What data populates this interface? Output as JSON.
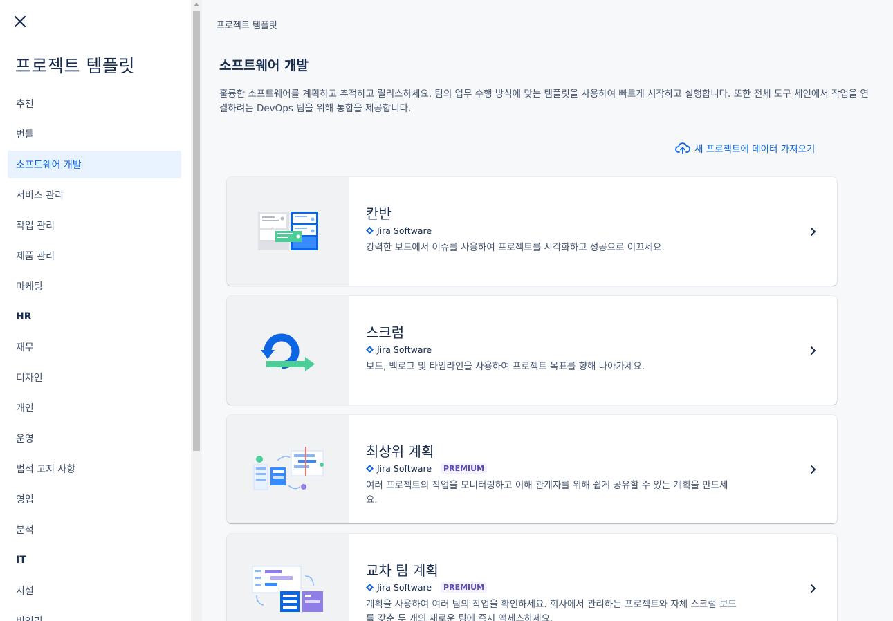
{
  "sidebar": {
    "title": "프로젝트 템플릿",
    "items": [
      {
        "label": "추천"
      },
      {
        "label": "번들"
      },
      {
        "label": "소프트웨어 개발"
      },
      {
        "label": "서비스 관리"
      },
      {
        "label": "작업 관리"
      },
      {
        "label": "제품 관리"
      },
      {
        "label": "마케팅"
      },
      {
        "label": "HR"
      },
      {
        "label": "재무"
      },
      {
        "label": "디자인"
      },
      {
        "label": "개인"
      },
      {
        "label": "운영"
      },
      {
        "label": "법적 고지 사항"
      },
      {
        "label": "영업"
      },
      {
        "label": "분석"
      },
      {
        "label": "IT"
      },
      {
        "label": "시설"
      },
      {
        "label": "비영리"
      }
    ],
    "active_index": 2
  },
  "main": {
    "breadcrumb": "프로젝트 템플릿",
    "title": "소프트웨어 개발",
    "description": "훌륭한 소프트웨어를 계획하고 추적하고 릴리스하세요. 팀의 업무 수행 방식에 맞는 템플릿을 사용하여 빠르게 시작하고 실행합니다. 또한 전체 도구 체인에서 작업을 연결하려는 DevOps 팀을 위해 통합을 제공합니다.",
    "import_link": "새 프로젝트에 데이터 가져오기",
    "cards": [
      {
        "title": "칸반",
        "product": "Jira Software",
        "badge": "",
        "description": "강력한 보드에서 이슈를 사용하여 프로젝트를 시각화하고 성공으로 이끄세요."
      },
      {
        "title": "스크럼",
        "product": "Jira Software",
        "badge": "",
        "description": "보드, 백로그 및 타임라인을 사용하여 프로젝트 목표를 향해 나아가세요."
      },
      {
        "title": "최상위 계획",
        "product": "Jira Software",
        "badge": "PREMIUM",
        "description": "여러 프로젝트의 작업을 모니터링하고 이해 관계자를 위해 쉽게 공유할 수 있는 계획을 만드세요."
      },
      {
        "title": "교차 팀 계획",
        "product": "Jira Software",
        "badge": "PREMIUM",
        "description": "계획을 사용하여 여러 팀의 작업을 확인하세요. 회사에서 관리하는 프로젝트와 자체 스크럼 보드를 갖춘 두 개의 새로운 팀에 즉시 액세스하세요."
      }
    ]
  },
  "colors": {
    "accent": "#0c66e4",
    "active_bg": "#e9f2ff",
    "premium_text": "#5e4db2"
  },
  "icons": {
    "close": "close-icon",
    "upload": "cloud-upload-icon",
    "chevron": "chevron-right-icon",
    "jira": "jira-logo-icon"
  }
}
